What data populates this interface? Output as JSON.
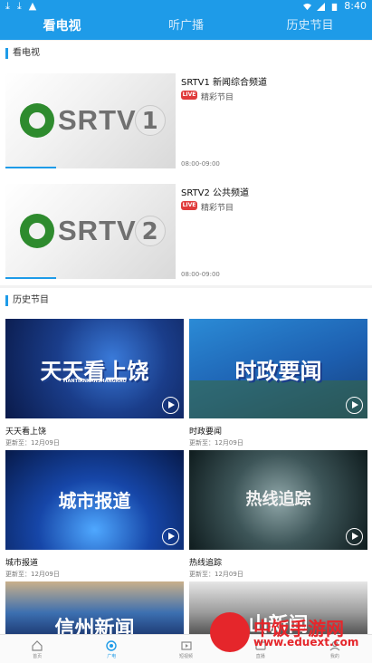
{
  "status_bar": {
    "time": "8:40"
  },
  "top_tabs": [
    {
      "label": "看电视"
    },
    {
      "label": "听广播"
    },
    {
      "label": "历史节目"
    }
  ],
  "tv_section": {
    "title": "看电视"
  },
  "channels": [
    {
      "logo_text": "SRTV",
      "logo_number": "1",
      "title": "SRTV1 新闻综合频道",
      "live_badge": "LIVE",
      "subtitle": "精彩节目",
      "time": "08:00-09:00"
    },
    {
      "logo_text": "SRTV",
      "logo_number": "2",
      "title": "SRTV2 公共频道",
      "live_badge": "LIVE",
      "subtitle": "精彩节目",
      "time": "08:00-09:00"
    }
  ],
  "history_section": {
    "title": "历史节目"
  },
  "programs": [
    {
      "thumb_text": "天天看上饶",
      "thumb_sub": "TIANTIANKANSHANGRAO",
      "title": "天天看上饶",
      "updated": "更新至：12月09日"
    },
    {
      "thumb_text": "时政要闻",
      "title": "时政要闻",
      "updated": "更新至：12月09日"
    },
    {
      "thumb_text": "城市报道",
      "title": "城市报道",
      "updated": "更新至：12月09日"
    },
    {
      "thumb_text": "热线追踪",
      "title": "热线追踪",
      "updated": "更新至：12月09日"
    },
    {
      "thumb_text": "信州新闻",
      "title": "",
      "updated": ""
    },
    {
      "thumb_text": "山新闻",
      "title": "",
      "updated": ""
    }
  ],
  "bottom_nav": [
    {
      "label": "首页",
      "icon": "home-icon"
    },
    {
      "label": "广电",
      "icon": "broadcast-icon"
    },
    {
      "label": "短视频",
      "icon": "short-video-icon"
    },
    {
      "label": "直播",
      "icon": "live-icon"
    },
    {
      "label": "我的",
      "icon": "profile-icon"
    }
  ],
  "watermark": {
    "text": "中饭手游网",
    "url": "www.eduext.com"
  },
  "colors": {
    "accent": "#1e9be8",
    "live": "#e03c3c",
    "watermark": "#e5262b"
  }
}
